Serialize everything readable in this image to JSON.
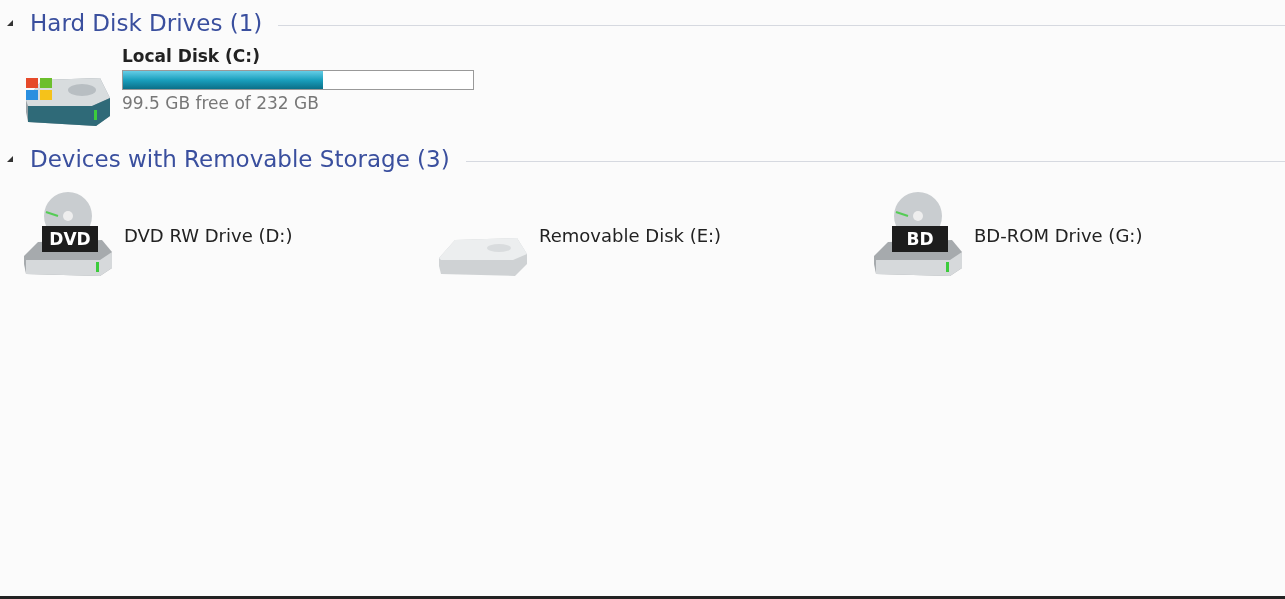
{
  "groups": [
    {
      "title": "Hard Disk Drives (1)",
      "expanded": true,
      "items": [
        {
          "kind": "hdd",
          "name": "Local Disk  (C:)",
          "level": 0.57,
          "free": "99.5 GB free of 232 GB"
        }
      ]
    },
    {
      "title": "Devices with Removable Storage (3)",
      "expanded": true,
      "items": [
        {
          "kind": "optical",
          "name": "DVD RW Drive (D:)",
          "disc_label": "DVD"
        },
        {
          "kind": "removable",
          "name": "Removable Disk (E:)"
        },
        {
          "kind": "optical",
          "name": "BD-ROM Drive (G:)",
          "disc_label": "BD"
        }
      ]
    }
  ]
}
